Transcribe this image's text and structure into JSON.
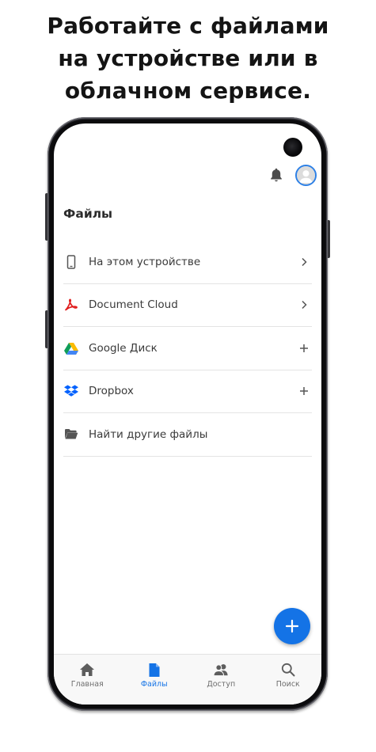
{
  "promo": {
    "headline_line1": "Работайте с файлами",
    "headline_line2": "на устройстве или в",
    "headline_line3": "облачном сервисе."
  },
  "app": {
    "page_title": "Файлы",
    "top_icons": [
      "bell-icon",
      "user-avatar-icon"
    ],
    "locations": [
      {
        "label": "На этом устройстве",
        "icon": "phone-icon",
        "action": "chevron-right-icon"
      },
      {
        "label": "Document Cloud",
        "icon": "acrobat-icon",
        "action": "chevron-right-icon"
      },
      {
        "label": "Google Диск",
        "icon": "google-drive-icon",
        "action": "plus-icon"
      },
      {
        "label": "Dropbox",
        "icon": "dropbox-icon",
        "action": "plus-icon"
      },
      {
        "label": "Найти другие файлы",
        "icon": "folder-icon",
        "action": null
      }
    ],
    "fab_icon": "plus-icon",
    "bottom_nav": [
      {
        "label": "Главная",
        "icon": "home-icon",
        "active": false
      },
      {
        "label": "Файлы",
        "icon": "file-icon",
        "active": true
      },
      {
        "label": "Доступ",
        "icon": "people-icon",
        "active": false
      },
      {
        "label": "Поиск",
        "icon": "search-icon",
        "active": false
      }
    ]
  },
  "colors": {
    "accent": "#1473e6",
    "acrobat_red": "#e01c1c",
    "dropbox_blue": "#0061fe",
    "divider": "#e4e4e4"
  }
}
